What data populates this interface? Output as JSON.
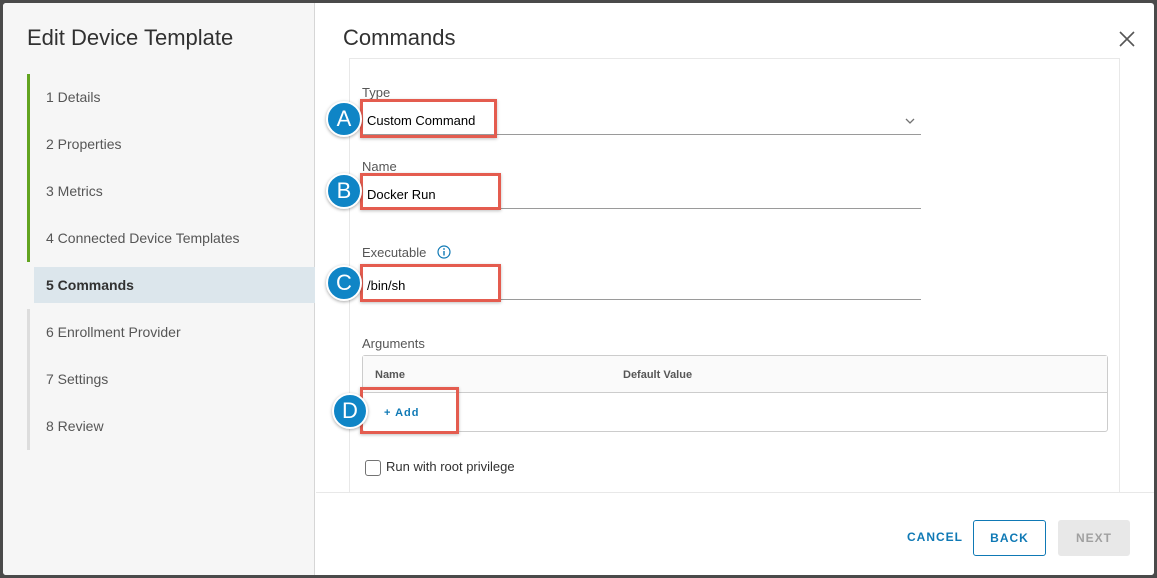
{
  "modal": {
    "title": "Edit Device Template"
  },
  "steps": [
    {
      "label": "1 Details",
      "state": "done"
    },
    {
      "label": "2 Properties",
      "state": "done"
    },
    {
      "label": "3 Metrics",
      "state": "done"
    },
    {
      "label": "4 Connected Device Templates",
      "state": "done"
    },
    {
      "label": "5 Commands",
      "state": "active"
    },
    {
      "label": "6 Enrollment Provider",
      "state": "pending"
    },
    {
      "label": "7 Settings",
      "state": "pending"
    },
    {
      "label": "8 Review",
      "state": "pending"
    }
  ],
  "content": {
    "title": "Commands",
    "type_label": "Type",
    "type_value": "Custom Command",
    "name_label": "Name",
    "name_value": "Docker Run",
    "executable_label": "Executable",
    "executable_value": "/bin/sh",
    "arguments_label": "Arguments",
    "args_columns": [
      "Name",
      "Default Value"
    ],
    "add_label": "+ Add",
    "root_privilege_label": "Run with root privilege",
    "root_privilege_checked": false
  },
  "annotations": [
    "A",
    "B",
    "C",
    "D"
  ],
  "footer": {
    "cancel": "CANCEL",
    "back": "BACK",
    "next": "NEXT"
  },
  "colors": {
    "accent": "#0f79b5",
    "progress_done": "#62a420",
    "highlight": "#e45c4f",
    "badge": "#0f85c6"
  }
}
